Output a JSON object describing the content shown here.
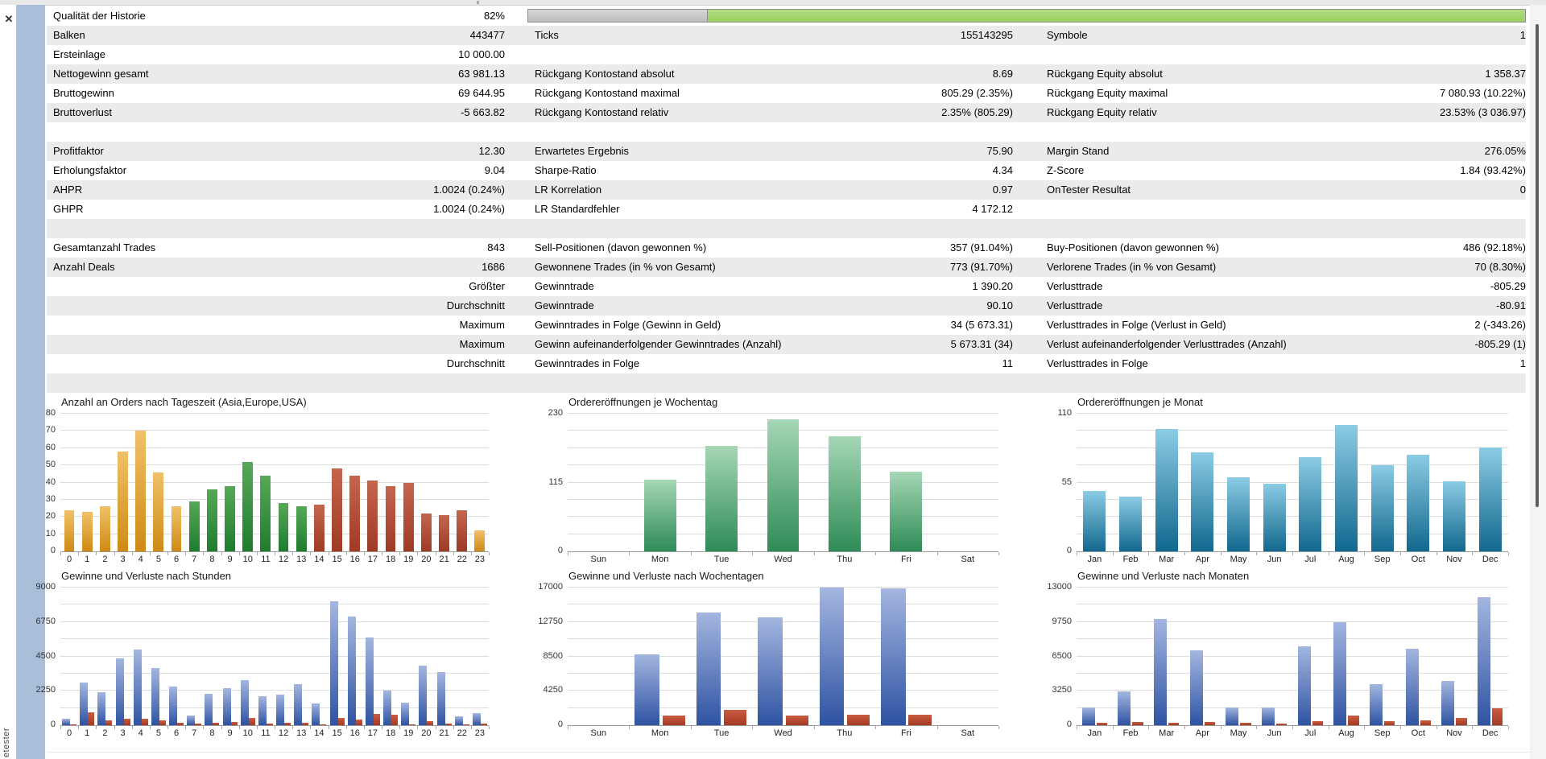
{
  "panel": {
    "close_label": "✕",
    "vertical_tab_label": "etester"
  },
  "colors": {
    "row_shade": "#ebebeb",
    "strip_blue": "#a9bed8",
    "progress_gray": "#c6c6c6",
    "progress_green": "#9ccf60",
    "grid": "#dcdcdc",
    "axis": "#9a9a9a"
  },
  "progress": {
    "gray_pct": 18,
    "green_pct": 82
  },
  "table": {
    "rows": [
      {
        "c1": {
          "l": "Qualität der Historie",
          "v": "82%"
        },
        "progress": true
      },
      {
        "c1": {
          "l": "Balken",
          "v": "443477"
        },
        "c2": {
          "l": "Ticks",
          "v": "155143295"
        },
        "c3": {
          "l": "Symbole",
          "v": "1"
        }
      },
      {
        "c1": {
          "l": "Ersteinlage",
          "v": "10 000.00"
        }
      },
      {
        "c1": {
          "l": "Nettogewinn gesamt",
          "v": "63 981.13"
        },
        "c2": {
          "l": "Rückgang Kontostand absolut",
          "v": "8.69"
        },
        "c3": {
          "l": "Rückgang Equity absolut",
          "v": "1 358.37"
        }
      },
      {
        "c1": {
          "l": "Bruttogewinn",
          "v": "69 644.95"
        },
        "c2": {
          "l": "Rückgang Kontostand maximal",
          "v": "805.29 (2.35%)"
        },
        "c3": {
          "l": "Rückgang Equity maximal",
          "v": "7 080.93 (10.22%)"
        }
      },
      {
        "c1": {
          "l": "Bruttoverlust",
          "v": "-5 663.82"
        },
        "c2": {
          "l": "Rückgang Kontostand relativ",
          "v": "2.35% (805.29)"
        },
        "c3": {
          "l": "Rückgang Equity relativ",
          "v": "23.53% (3 036.97)"
        }
      },
      {},
      {
        "c1": {
          "l": "Profitfaktor",
          "v": "12.30"
        },
        "c2": {
          "l": "Erwartetes Ergebnis",
          "v": "75.90"
        },
        "c3": {
          "l": "Margin Stand",
          "v": "276.05%"
        }
      },
      {
        "c1": {
          "l": "Erholungsfaktor",
          "v": "9.04"
        },
        "c2": {
          "l": "Sharpe-Ratio",
          "v": "4.34"
        },
        "c3": {
          "l": "Z-Score",
          "v": "1.84 (93.42%)"
        }
      },
      {
        "c1": {
          "l": "AHPR",
          "v": "1.0024 (0.24%)"
        },
        "c2": {
          "l": "LR Korrelation",
          "v": "0.97"
        },
        "c3": {
          "l": "OnTester Resultat",
          "v": "0"
        }
      },
      {
        "c1": {
          "l": "GHPR",
          "v": "1.0024 (0.24%)"
        },
        "c2": {
          "l": "LR Standardfehler",
          "v": "4 172.12"
        }
      },
      {},
      {
        "c1": {
          "l": "Gesamtanzahl Trades",
          "v": "843"
        },
        "c2": {
          "l": "Sell-Positionen (davon gewonnen %)",
          "v": "357 (91.04%)"
        },
        "c3": {
          "l": "Buy-Positionen (davon gewonnen %)",
          "v": "486 (92.18%)"
        }
      },
      {
        "c1": {
          "l": "Anzahl Deals",
          "v": "1686"
        },
        "c2": {
          "l": "Gewonnene Trades (in % von Gesamt)",
          "v": "773 (91.70%)"
        },
        "c3": {
          "l": "Verlorene Trades (in % von Gesamt)",
          "v": "70 (8.30%)"
        }
      },
      {
        "c1": {
          "l": "",
          "v": "Größter"
        },
        "c2": {
          "l": "Gewinntrade",
          "v": "1 390.20"
        },
        "c3": {
          "l": "Verlusttrade",
          "v": "-805.29"
        }
      },
      {
        "c1": {
          "l": "",
          "v": "Durchschnitt"
        },
        "c2": {
          "l": "Gewinntrade",
          "v": "90.10"
        },
        "c3": {
          "l": "Verlusttrade",
          "v": "-80.91"
        }
      },
      {
        "c1": {
          "l": "",
          "v": "Maximum"
        },
        "c2": {
          "l": "Gewinntrades in Folge (Gewinn in Geld)",
          "v": "34 (5 673.31)"
        },
        "c3": {
          "l": "Verlusttrades in Folge (Verlust in Geld)",
          "v": "2 (-343.26)"
        }
      },
      {
        "c1": {
          "l": "",
          "v": "Maximum"
        },
        "c2": {
          "l": "Gewinn aufeinanderfolgender Gewinntrades (Anzahl)",
          "v": "5 673.31 (34)"
        },
        "c3": {
          "l": "Verlust aufeinanderfolgender Verlusttrades (Anzahl)",
          "v": "-805.29 (1)"
        }
      },
      {
        "c1": {
          "l": "",
          "v": "Durchschnitt"
        },
        "c2": {
          "l": "Gewinntrades in Folge",
          "v": "11"
        },
        "c3": {
          "l": "Verlusttrades in Folge",
          "v": "1"
        }
      },
      {}
    ]
  },
  "chart_data": [
    {
      "type": "bar",
      "title": "Anzahl an Orders nach Tageszeit (Asia,Europe,USA)",
      "categories": [
        "0",
        "1",
        "2",
        "3",
        "4",
        "5",
        "6",
        "7",
        "8",
        "9",
        "10",
        "11",
        "12",
        "13",
        "14",
        "15",
        "16",
        "17",
        "18",
        "19",
        "20",
        "21",
        "22",
        "23"
      ],
      "values": [
        24,
        23,
        26,
        58,
        70,
        46,
        26,
        29,
        36,
        38,
        52,
        44,
        28,
        26,
        27,
        48,
        44,
        41,
        38,
        40,
        22,
        21,
        24,
        12
      ],
      "groups": [
        "asia",
        "asia",
        "asia",
        "asia",
        "asia",
        "asia",
        "asia",
        "europe",
        "europe",
        "europe",
        "europe",
        "europe",
        "europe",
        "europe",
        "usa",
        "usa",
        "usa",
        "usa",
        "usa",
        "usa",
        "usa",
        "usa",
        "usa",
        "asia"
      ],
      "palette": {
        "asia": {
          "top": "#f0c169",
          "bottom": "#cf8a14"
        },
        "europe": {
          "top": "#57a857",
          "bottom": "#1e7c2e"
        },
        "usa": {
          "top": "#c4664f",
          "bottom": "#9e3a25"
        }
      },
      "ylim": [
        0,
        80
      ],
      "yticks": [
        0,
        10,
        20,
        30,
        40,
        50,
        60,
        70,
        80
      ],
      "grid_divisions": 8
    },
    {
      "type": "bar",
      "title": "Ordereröffnungen je Wochentag",
      "categories": [
        "Sun",
        "Mon",
        "Tue",
        "Wed",
        "Thu",
        "Fri",
        "Sat"
      ],
      "values": [
        0,
        120,
        176,
        221,
        193,
        133,
        0
      ],
      "color": {
        "top": "#a6d7b6",
        "bottom": "#2e8b57"
      },
      "ylim": [
        0,
        230
      ],
      "yticks": [
        0,
        115,
        230
      ],
      "grid_divisions": 8
    },
    {
      "type": "bar",
      "title": "Ordereröffnungen je Monat",
      "categories": [
        "Jan",
        "Feb",
        "Mar",
        "Apr",
        "May",
        "Jun",
        "Jul",
        "Aug",
        "Sep",
        "Oct",
        "Nov",
        "Dec"
      ],
      "values": [
        48,
        44,
        98,
        79,
        59,
        54,
        75,
        101,
        69,
        77,
        56,
        83
      ],
      "color": {
        "top": "#8ccbe4",
        "bottom": "#11688e"
      },
      "ylim": [
        0,
        110
      ],
      "yticks": [
        0,
        55,
        110
      ],
      "grid_divisions": 8
    },
    {
      "type": "bar",
      "title": "Gewinne und Verluste nach Stunden",
      "categories": [
        "0",
        "1",
        "2",
        "3",
        "4",
        "5",
        "6",
        "7",
        "8",
        "9",
        "10",
        "11",
        "12",
        "13",
        "14",
        "15",
        "16",
        "17",
        "18",
        "19",
        "20",
        "21",
        "22",
        "23"
      ],
      "series": [
        {
          "name": "Gewinne",
          "values": [
            420,
            2800,
            2150,
            4350,
            4950,
            3750,
            2550,
            620,
            2050,
            2400,
            2950,
            1900,
            2000,
            2700,
            1400,
            8100,
            7100,
            5750,
            2250,
            1500,
            3900,
            3450,
            600,
            800
          ],
          "color": {
            "top": "#a4b6e0",
            "bottom": "#2f53a2"
          }
        },
        {
          "name": "Verluste",
          "values": [
            30,
            850,
            320,
            400,
            400,
            330,
            140,
            100,
            180,
            200,
            500,
            100,
            170,
            180,
            40,
            480,
            380,
            760,
            660,
            60,
            260,
            100,
            30,
            110
          ],
          "color": {
            "top": "#ca5c42",
            "bottom": "#a23a22"
          }
        }
      ],
      "ylim": [
        0,
        9000
      ],
      "yticks": [
        0,
        2250,
        4500,
        6750,
        9000
      ],
      "grid_divisions": 8
    },
    {
      "type": "bar",
      "title": "Gewinne und Verluste nach Wochentagen",
      "categories": [
        "Sun",
        "Mon",
        "Tue",
        "Wed",
        "Thu",
        "Fri",
        "Sat"
      ],
      "series": [
        {
          "name": "Gewinne",
          "values": [
            0,
            8750,
            13900,
            13350,
            17000,
            16950,
            0
          ],
          "color": {
            "top": "#a4b6e0",
            "bottom": "#2f53a2"
          }
        },
        {
          "name": "Verluste",
          "values": [
            0,
            1150,
            1850,
            1150,
            1250,
            1300,
            0
          ],
          "color": {
            "top": "#ca5c42",
            "bottom": "#a23a22"
          }
        }
      ],
      "ylim": [
        0,
        17000
      ],
      "yticks": [
        0,
        4250,
        8500,
        12750,
        17000
      ],
      "grid_divisions": 8
    },
    {
      "type": "bar",
      "title": "Gewinne und Verluste nach Monaten",
      "categories": [
        "Jan",
        "Feb",
        "Mar",
        "Apr",
        "May",
        "Jun",
        "Jul",
        "Aug",
        "Sep",
        "Oct",
        "Nov",
        "Dec"
      ],
      "series": [
        {
          "name": "Gewinne",
          "values": [
            1700,
            3200,
            10050,
            7100,
            1650,
            1700,
            7450,
            9750,
            3900,
            7200,
            4150,
            12100
          ],
          "color": {
            "top": "#a4b6e0",
            "bottom": "#2f53a2"
          }
        },
        {
          "name": "Verluste",
          "values": [
            220,
            320,
            220,
            320,
            200,
            160,
            380,
            950,
            350,
            480,
            650,
            1600
          ],
          "color": {
            "top": "#ca5c42",
            "bottom": "#a23a22"
          }
        }
      ],
      "ylim": [
        0,
        13000
      ],
      "yticks": [
        0,
        3250,
        6500,
        9750,
        13000
      ],
      "grid_divisions": 8
    }
  ]
}
